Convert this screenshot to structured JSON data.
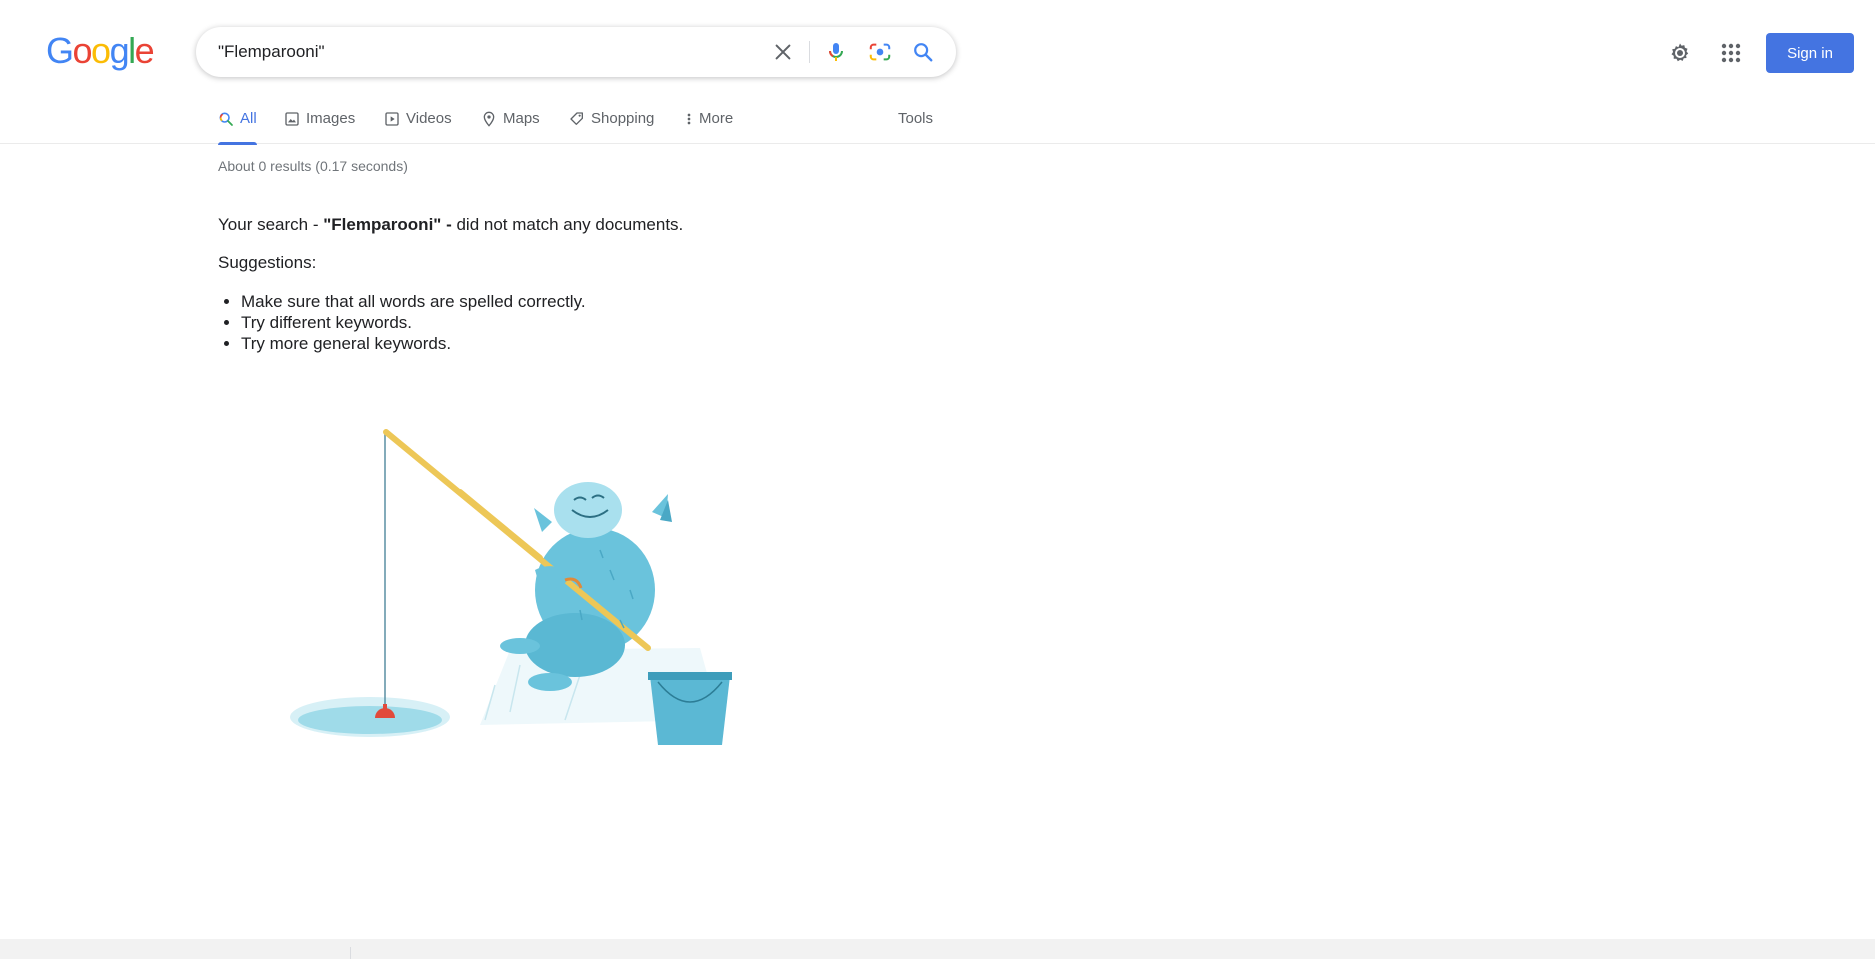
{
  "logo": {
    "letters": [
      "G",
      "o",
      "o",
      "g",
      "l",
      "e"
    ],
    "colors": [
      "#4285f4",
      "#ea4335",
      "#fbbc05",
      "#4285f4",
      "#34a853",
      "#ea4335"
    ]
  },
  "search": {
    "value": "\"Flemparooni\"",
    "placeholder": ""
  },
  "header": {
    "signin_label": "Sign in",
    "accent": "#4474e1"
  },
  "tabs": [
    {
      "label": "All",
      "icon": "search-icon"
    },
    {
      "label": "Images",
      "icon": "image-icon"
    },
    {
      "label": "Videos",
      "icon": "play-icon"
    },
    {
      "label": "Maps",
      "icon": "map-pin-icon"
    },
    {
      "label": "Shopping",
      "icon": "tag-icon"
    },
    {
      "label": "More",
      "icon": "more-vert-icon"
    }
  ],
  "tools_label": "Tools",
  "results": {
    "stats": "About 0 results (0.17 seconds)",
    "message_prefix": "Your search - ",
    "query": "\"Flemparooni\"",
    "message_dash": " - ",
    "message_suffix": "did not match any documents.",
    "suggestions_title": "Suggestions:",
    "suggestions": [
      "Make sure that all words are spelled correctly.",
      "Try different keywords.",
      "Try more general keywords."
    ]
  }
}
